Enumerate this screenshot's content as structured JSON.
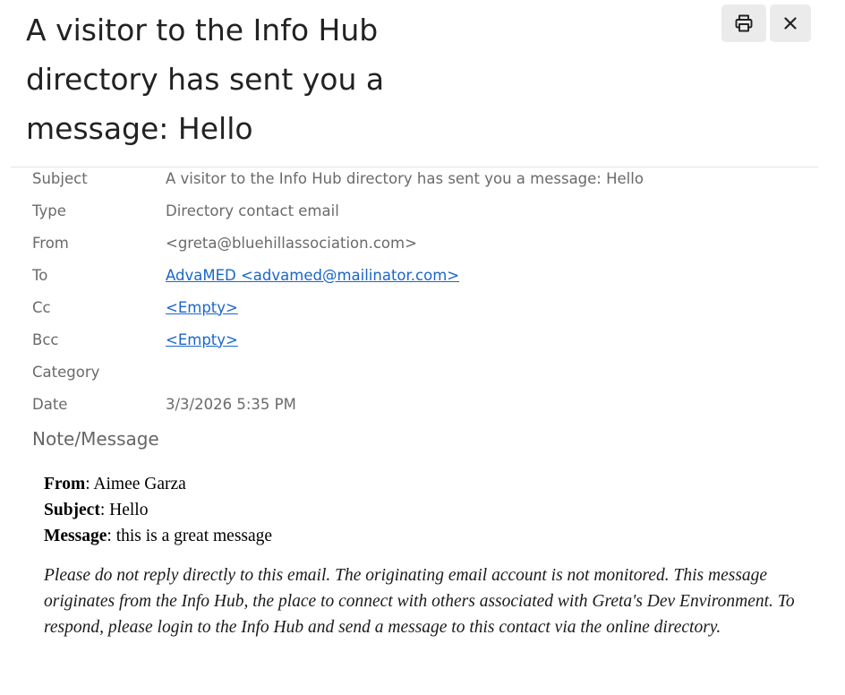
{
  "header": {
    "title": "A visitor to the Info Hub directory has sent you a message: Hello",
    "print_icon": "printer-icon",
    "close_icon": "close-icon"
  },
  "properties": [
    {
      "label": "Subject",
      "value": "A visitor to the Info Hub directory has sent you a message: Hello",
      "link": false
    },
    {
      "label": "Type",
      "value": "Directory contact email",
      "link": false
    },
    {
      "label": "From",
      "value": "<greta@bluehillassociation.com>",
      "link": false
    },
    {
      "label": "To",
      "value": "AdvaMED <advamed@mailinator.com>",
      "link": true
    },
    {
      "label": "Cc",
      "value": "<Empty>",
      "link": true
    },
    {
      "label": "Bcc",
      "value": "<Empty>",
      "link": true
    },
    {
      "label": "Category",
      "value": "",
      "link": false
    },
    {
      "label": "Date",
      "value": "3/3/2026 5:35 PM",
      "link": false
    }
  ],
  "note": {
    "heading": "Note/Message",
    "from_label": "From",
    "from_value": ": Aimee Garza",
    "subject_label": "Subject",
    "subject_value": ": Hello",
    "message_label": "Message",
    "message_value": ": this is a great message",
    "disclaimer": "Please do not reply directly to this email. The originating email account is not monitored. This message originates from the Info Hub, the place to connect with others associated with Greta's Dev Environment. To respond, please login to the Info Hub and send a message to this contact via the online directory."
  },
  "colors": {
    "link": "#1a66cc",
    "label": "#6a6a6a",
    "button_bg": "#ebebeb"
  }
}
